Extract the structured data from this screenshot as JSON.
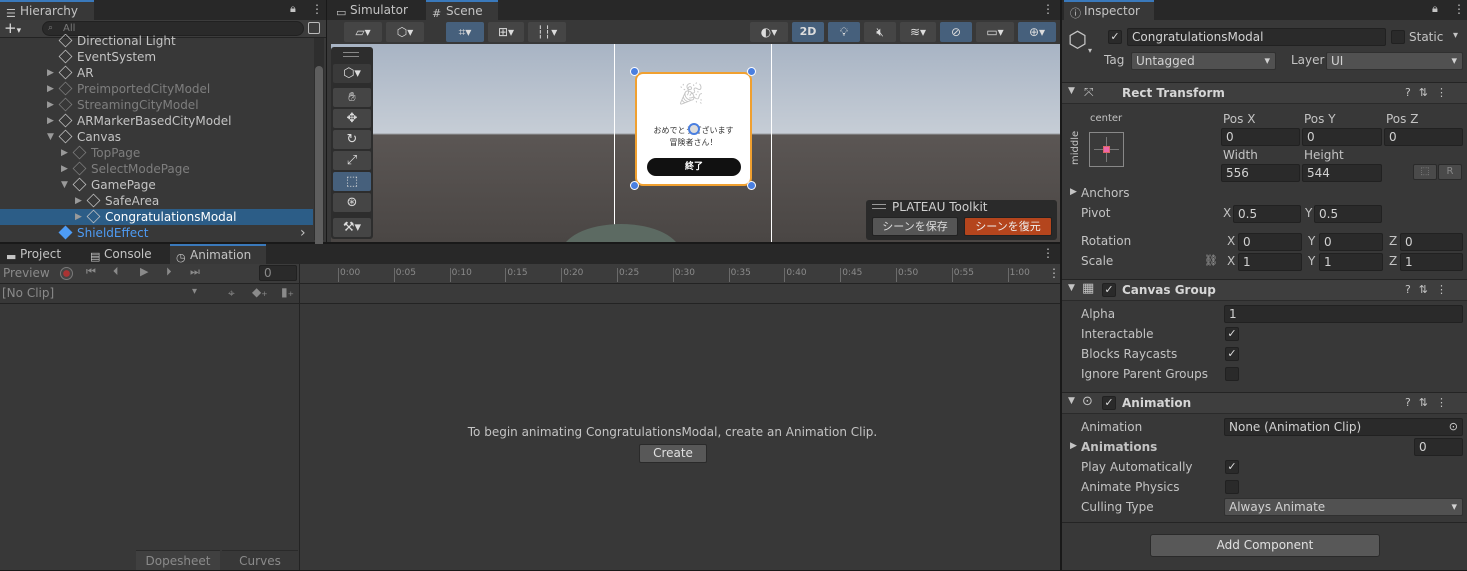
{
  "hierarchy": {
    "tab_label": "Hierarchy",
    "search_placeholder": "All",
    "add_label": "+",
    "items": [
      {
        "label": "Directional Light",
        "state": "normal"
      },
      {
        "label": "EventSystem",
        "state": "normal"
      },
      {
        "label": "AR",
        "state": "normal"
      },
      {
        "label": "PreimportedCityModel",
        "state": "dim"
      },
      {
        "label": "StreamingCityModel",
        "state": "dim"
      },
      {
        "label": "ARMarkerBasedCityModel",
        "state": "normal"
      },
      {
        "label": "Canvas",
        "state": "normal"
      },
      {
        "label": "TopPage",
        "state": "dim"
      },
      {
        "label": "SelectModePage",
        "state": "dim"
      },
      {
        "label": "GamePage",
        "state": "normal"
      },
      {
        "label": "SafeArea",
        "state": "normal"
      },
      {
        "label": "CongratulationsModal",
        "state": "selected"
      },
      {
        "label": "ShieldEffect",
        "state": "prefab"
      }
    ]
  },
  "scene": {
    "tabs": [
      "Simulator",
      "Scene"
    ],
    "toolbar_2d": "2D",
    "modal": {
      "line1": "おめでとうございます",
      "line2": "冒険者さん！",
      "button": "終了"
    },
    "overlay": {
      "title": "PLATEAU Toolkit",
      "save_button": "シーンを保存",
      "restore_button": "シーンを復元"
    }
  },
  "bottom_tabs": [
    "Project",
    "Console",
    "Animation"
  ],
  "animation": {
    "preview_label": "Preview",
    "frame_value": "0",
    "clip_dropdown": "[No Clip]",
    "ruler_ticks": [
      "0:00",
      "0:05",
      "0:10",
      "0:15",
      "0:20",
      "0:25",
      "0:30",
      "0:35",
      "0:40",
      "0:45",
      "0:50",
      "0:55",
      "1:00"
    ],
    "message": "To begin animating CongratulationsModal, create an Animation Clip.",
    "create_button": "Create",
    "view_tabs": [
      "Dopesheet",
      "Curves"
    ]
  },
  "inspector": {
    "tab_label": "Inspector",
    "object_name": "CongratulationsModal",
    "static_label": "Static",
    "tag_label": "Tag",
    "tag_value": "Untagged",
    "layer_label": "Layer",
    "layer_value": "UI",
    "rect_transform": {
      "title": "Rect Transform",
      "anchor_h": "center",
      "anchor_v": "middle",
      "pos_x_label": "Pos X",
      "pos_x": "0",
      "pos_y_label": "Pos Y",
      "pos_y": "0",
      "pos_z_label": "Pos Z",
      "pos_z": "0",
      "width_label": "Width",
      "width": "556",
      "height_label": "Height",
      "height": "544",
      "r_button": "R",
      "anchors_label": "Anchors",
      "pivot_label": "Pivot",
      "pivot_x": "0.5",
      "pivot_y": "0.5",
      "rotation_label": "Rotation",
      "rot_x": "0",
      "rot_y": "0",
      "rot_z": "0",
      "scale_label": "Scale",
      "scale_x": "1",
      "scale_y": "1",
      "scale_z": "1",
      "x": "X",
      "y": "Y",
      "z": "Z"
    },
    "canvas_group": {
      "title": "Canvas Group",
      "alpha_label": "Alpha",
      "alpha": "1",
      "interactable_label": "Interactable",
      "interactable": true,
      "blocks_raycasts_label": "Blocks Raycasts",
      "blocks_raycasts": true,
      "ignore_parent_label": "Ignore Parent Groups",
      "ignore_parent": false
    },
    "animation": {
      "title": "Animation",
      "animation_label": "Animation",
      "animation_value": "None (Animation Clip)",
      "animations_label": "Animations",
      "animations_count": "0",
      "play_auto_label": "Play Automatically",
      "play_auto": true,
      "animate_physics_label": "Animate Physics",
      "animate_physics": false,
      "culling_label": "Culling Type",
      "culling_value": "Always Animate"
    },
    "add_component": "Add Component"
  },
  "colors": {
    "selection": "#2c5d87",
    "accent_tab": "#3a79bb",
    "restore_button": "#b4451d",
    "modal_border": "#f0a030"
  }
}
